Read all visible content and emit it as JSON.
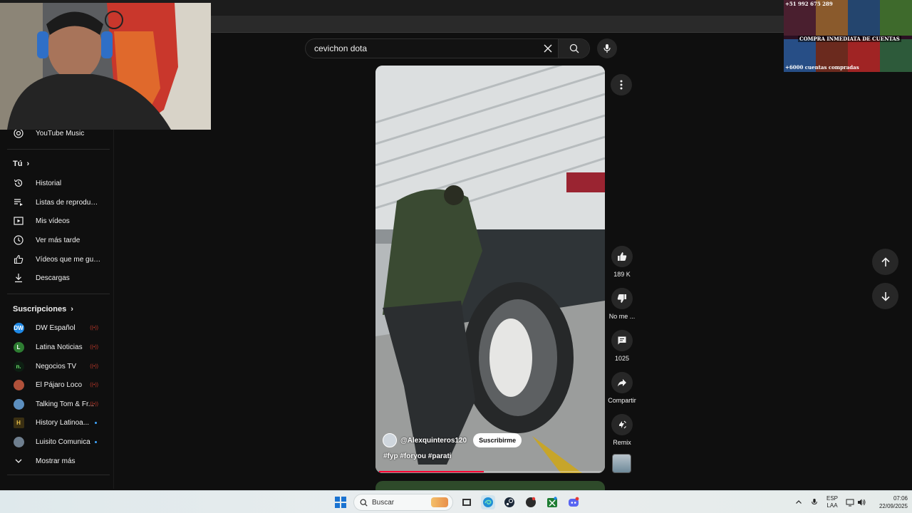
{
  "search": {
    "query": "cevichon dota"
  },
  "sidebar": {
    "top_item": "YouTube Music",
    "you_header": "Tú",
    "you_items": [
      "Historial",
      "Listas de reproducc...",
      "Mis vídeos",
      "Ver más tarde",
      "Vídeos que me gus...",
      "Descargas"
    ],
    "subs_header": "Suscripciones",
    "subscriptions": [
      {
        "name": "DW Español",
        "avatar": "DW",
        "color": "#1e88e5",
        "status": "live"
      },
      {
        "name": "Latina Noticias",
        "avatar": "L",
        "color": "#2e7d32",
        "status": "live"
      },
      {
        "name": "Negocios TV",
        "avatar": "n.",
        "color": "#0d1f12",
        "status": "live"
      },
      {
        "name": "El Pájaro Loco",
        "avatar": "",
        "color": "#b0513a",
        "status": "live"
      },
      {
        "name": "Talking Tom & Fr...",
        "avatar": "",
        "color": "#5c8fbf",
        "status": "live"
      },
      {
        "name": "History Latinoa...",
        "avatar": "H",
        "color": "#3a2f12",
        "status": "new"
      },
      {
        "name": "Luisito Comunica",
        "avatar": "",
        "color": "#6f7f8f",
        "status": "new"
      }
    ],
    "show_more": "Mostrar más",
    "live_label": "((•))"
  },
  "promo": {
    "phone": "+51 992 675 289",
    "banner": "COMPRA INMEDIATA DE CUENTAS",
    "count": "+6000 cuentas compradas"
  },
  "video": {
    "channel": "@Alexquinteros120",
    "subscribe_label": "Suscribirme",
    "tags": "#fyp #foryou #parati",
    "progress": 0.47
  },
  "actions": {
    "likes": "189 K",
    "dislike": "No me ...",
    "comments": "1025",
    "share": "Compartir",
    "remix": "Remix"
  },
  "taskbar": {
    "search_label": "Buscar",
    "lang_top": "ESP",
    "lang_bottom": "LAA",
    "time": "07:06",
    "date": "22/09/2025"
  }
}
